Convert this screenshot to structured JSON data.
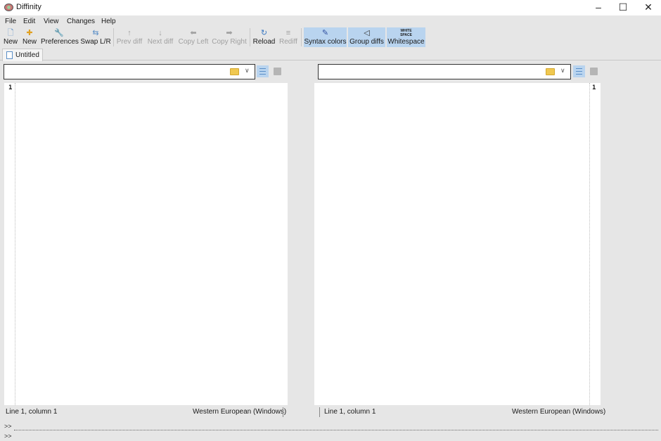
{
  "window": {
    "title": "Diffinity",
    "minimize_glyph": "–",
    "maximize_glyph": "☐",
    "close_glyph": "✕"
  },
  "menu": [
    "File",
    "Edit",
    "View",
    "Changes",
    "Help"
  ],
  "toolbar": {
    "buttons": [
      {
        "label": "New",
        "icon": "new-document-icon",
        "glyph": "🗋",
        "state": "enabled"
      },
      {
        "label": "New",
        "icon": "new-folder-compare-icon",
        "glyph": "✚",
        "state": "enabled"
      },
      {
        "label": "Preferences",
        "icon": "wrench-icon",
        "glyph": "🔧",
        "state": "enabled"
      },
      {
        "label": "Swap L/R",
        "icon": "swap-icon",
        "glyph": "⇆",
        "state": "enabled"
      },
      {
        "label": "Prev diff",
        "icon": "arrow-up-circle-icon",
        "glyph": "↑",
        "state": "disabled"
      },
      {
        "label": "Next diff",
        "icon": "arrow-down-circle-icon",
        "glyph": "↓",
        "state": "disabled"
      },
      {
        "label": "Copy Left",
        "icon": "arrow-left-icon",
        "glyph": "⬅",
        "state": "disabled"
      },
      {
        "label": "Copy Right",
        "icon": "arrow-right-icon",
        "glyph": "➡",
        "state": "disabled"
      },
      {
        "label": "Reload",
        "icon": "reload-icon",
        "glyph": "↻",
        "state": "enabled"
      },
      {
        "label": "Rediff",
        "icon": "rediff-icon",
        "glyph": "≡",
        "state": "disabled"
      },
      {
        "label": "Syntax colors",
        "icon": "pen-icon",
        "glyph": "✎",
        "state": "active"
      },
      {
        "label": "Group diffs",
        "icon": "group-diffs-icon",
        "glyph": "◁",
        "state": "active"
      },
      {
        "label": "Whitespace",
        "icon": "whitespace-icon",
        "glyph": "WHITE SPACE",
        "state": "active"
      }
    ]
  },
  "tabs": [
    {
      "label": "Untitled"
    }
  ],
  "left_pane": {
    "path_value": "",
    "line_number": "1",
    "status_position": "Line 1, column 1",
    "status_encoding": "Western European (Windows)"
  },
  "right_pane": {
    "path_value": "",
    "line_number": "1",
    "status_position": "Line 1, column 1",
    "status_encoding": "Western European (Windows)"
  },
  "console": {
    "prompt1": ">>",
    "prompt2": ">>"
  }
}
